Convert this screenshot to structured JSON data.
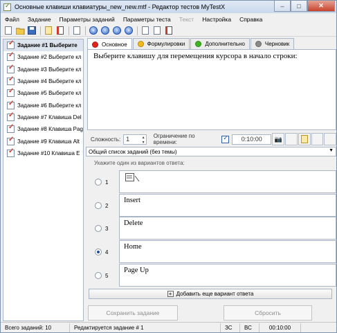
{
  "window": {
    "title": "Основные клавиши клавиатуры_new_new.mtf - Редактор тестов MyTestX",
    "minimize": "–",
    "maximize": "□",
    "close": "✕"
  },
  "menu": [
    "Файл",
    "Задание",
    "Параметры заданий",
    "Параметры теста",
    "Текст",
    "Настройка",
    "Справка"
  ],
  "toolbar": [
    "new-doc-icon",
    "open-folder-icon",
    "save-icon",
    "add-task-icon",
    "delete-task-icon",
    "task-props-icon",
    "nav-first-icon",
    "nav-prev-icon",
    "nav-next-icon",
    "nav-last-icon",
    "copy-icon",
    "paste-icon",
    "pdf-icon"
  ],
  "tasks": [
    "Задание #1 Выберите",
    "Задание #2 Выберите кл",
    "Задание #3 Выберите кл",
    "Задание #4 Выберите кл",
    "Задание #5 Выберите кл",
    "Задание #6 Выберите кл",
    "Задание #7 Клавиша Del",
    "Задание #8 Клавиша Pag",
    "Задание #9 Клавиша Alt",
    "Задание #10 Клавиша  E"
  ],
  "tabs": [
    {
      "label": "Основное",
      "color": "#e0241b"
    },
    {
      "label": "Формулировки",
      "color": "#f2b91a"
    },
    {
      "label": "Дополнительно",
      "color": "#3cb51e"
    },
    {
      "label": "Черновик",
      "color": "#8a8a8a"
    }
  ],
  "question": "Выберите клавишу для перемещения курсора  в начало строки:",
  "options": {
    "complexity_label": "Сложность:",
    "complexity_value": "1",
    "time_limit_label": "Ограничение по времени:",
    "time_limit_checked": true,
    "time_value": "0:10:00"
  },
  "task_list_select": "Общий список заданий (без темы)",
  "answer_hint": "Укажите один из вариантов ответа:",
  "answers": [
    {
      "num": "1",
      "text": "",
      "selected": false,
      "has_image": true
    },
    {
      "num": "2",
      "text": "Insert",
      "selected": false
    },
    {
      "num": "3",
      "text": "Delete",
      "selected": false
    },
    {
      "num": "4",
      "text": "Home",
      "selected": true
    },
    {
      "num": "5",
      "text": "Page Up",
      "selected": false
    }
  ],
  "add_answer_label": "Добавить еще вариант ответа",
  "save_task_label": "Сохранить задание",
  "reset_label": "Сбросить",
  "status": {
    "total": "Всего заданий: 10",
    "editing": "Редактируется задание # 1",
    "caps": "ЗС",
    "lang": "ВС",
    "time": "00:10:00"
  }
}
